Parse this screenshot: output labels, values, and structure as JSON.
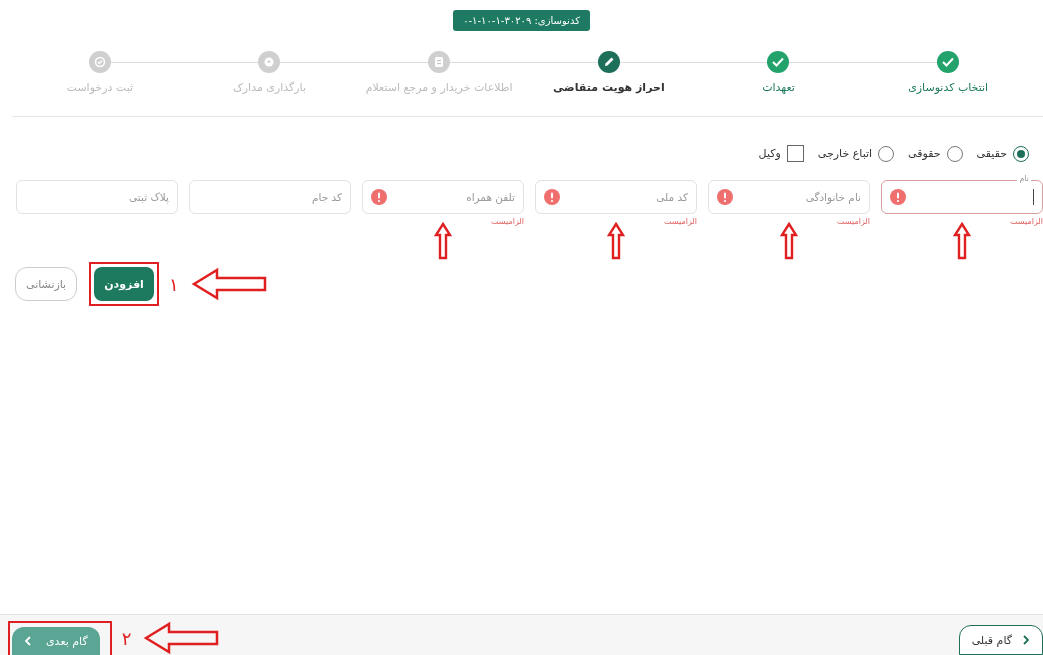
{
  "code_badge": "کدنوسازی: ۳۰۲۰۹-۱-۱۰-۱-۰",
  "steps": [
    {
      "label": "انتخاب کدنوسازی",
      "completed": true,
      "current": false
    },
    {
      "label": "تعهدات",
      "completed": true,
      "current": false
    },
    {
      "label": "احراز هویت متقاضی",
      "completed": false,
      "current": true
    },
    {
      "label": "اطلاعات خریدار و مرجع استعلام",
      "completed": false,
      "current": false
    },
    {
      "label": "بارگذاری مدارک",
      "completed": false,
      "current": false
    },
    {
      "label": "ثبت درخواست",
      "completed": false,
      "current": false
    }
  ],
  "person_types": [
    {
      "kind": "radio",
      "label": "حقیقی",
      "selected": true
    },
    {
      "kind": "radio",
      "label": "حقوقی",
      "selected": false
    },
    {
      "kind": "radio",
      "label": "اتباع خارجی",
      "selected": false
    },
    {
      "kind": "checkbox",
      "label": "وکیل",
      "checked": false
    }
  ],
  "fields": [
    {
      "label": "نام",
      "focused": true,
      "error": "الزامیست",
      "annotated": true
    },
    {
      "placeholder": "نام خانوادگی",
      "focused": false,
      "error": "الزامیست",
      "annotated": true
    },
    {
      "placeholder": "کد ملی",
      "focused": false,
      "error": "الزامیست",
      "annotated": true
    },
    {
      "placeholder": "تلفن همراه",
      "focused": false,
      "error": "الزامیست",
      "annotated": true
    },
    {
      "placeholder": "کد جام",
      "focused": false,
      "annotated": false
    },
    {
      "placeholder": "پلاک ثبتی",
      "focused": false,
      "annotated": false
    }
  ],
  "actions": [
    {
      "label": "افزودن",
      "kind": "primary",
      "annotation": "۱"
    },
    {
      "label": "بازنشانی",
      "kind": "outline"
    }
  ],
  "footer": {
    "prev": {
      "label": "گام قبلی"
    },
    "next": {
      "label": "گام بعدی",
      "annotation": "۲"
    }
  }
}
